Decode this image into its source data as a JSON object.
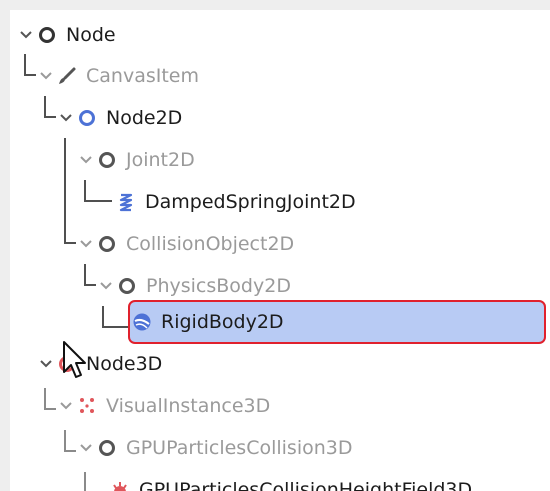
{
  "tree": {
    "items": [
      {
        "label": "Node",
        "icon": "node-circle-icon",
        "dim": false
      },
      {
        "label": "CanvasItem",
        "icon": "brush-icon",
        "dim": true
      },
      {
        "label": "Node2D",
        "icon": "node-circle-blue-icon",
        "dim": false
      },
      {
        "label": "Joint2D",
        "icon": "node-circle-icon",
        "dim": true
      },
      {
        "label": "DampedSpringJoint2D",
        "icon": "spring-icon",
        "dim": false
      },
      {
        "label": "CollisionObject2D",
        "icon": "node-circle-icon",
        "dim": true
      },
      {
        "label": "PhysicsBody2D",
        "icon": "node-circle-icon",
        "dim": true
      },
      {
        "label": "RigidBody2D",
        "icon": "rigidbody-globe-icon",
        "dim": false,
        "selected": true
      },
      {
        "label": "Node3D",
        "icon": "node3d-circle-icon",
        "dim": false
      },
      {
        "label": "VisualInstance3D",
        "icon": "dots-icon",
        "dim": true
      },
      {
        "label": "GPUParticlesCollision3D",
        "icon": "node-circle-icon",
        "dim": true
      },
      {
        "label": "GPUParticlesCollisionHeightField3D",
        "icon": "particles-collision-icon",
        "dim": false
      }
    ]
  },
  "colors": {
    "selection_fill": "#b8cbf4",
    "selection_border": "#e0212d",
    "node2d_blue": "#4d72d6",
    "node3d_red": "#e0565b",
    "text_dark": "#1c1c1c",
    "text_dim": "#9a9a9a"
  }
}
